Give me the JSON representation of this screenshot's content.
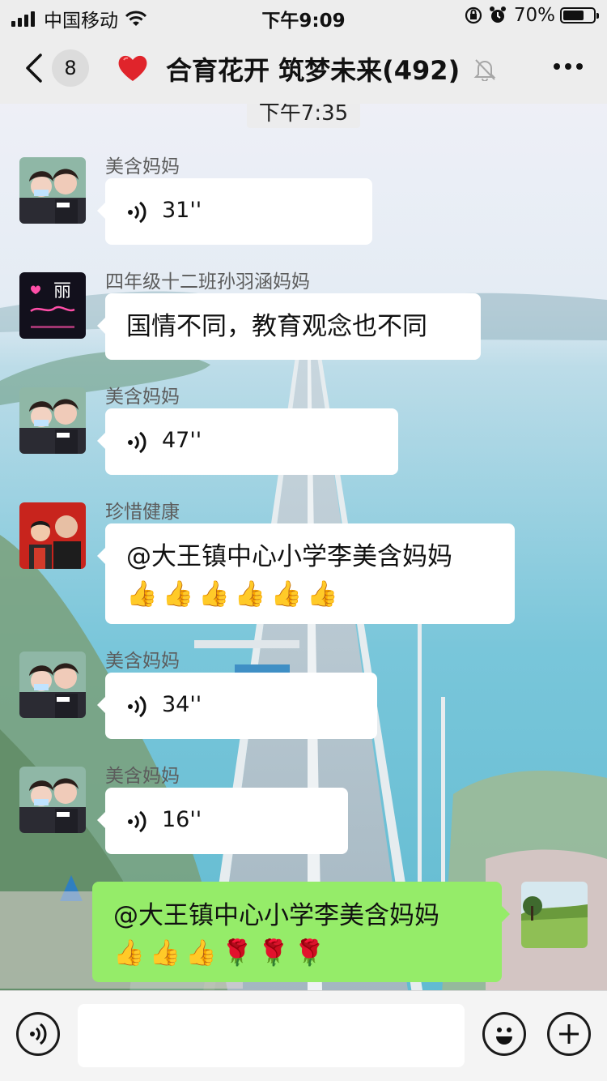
{
  "status_bar": {
    "carrier": "中国移动",
    "time": "下午9:09",
    "battery": "70%"
  },
  "nav": {
    "unread_count": "8",
    "title": "合育花开 筑梦未来(492)"
  },
  "time_divider": "下午7:35",
  "messages": [
    {
      "sender": "美含妈妈",
      "type": "voice",
      "duration": "31''"
    },
    {
      "sender": "四年级十二班孙羽涵妈妈",
      "type": "text",
      "text": "国情不同，教育观念也不同"
    },
    {
      "sender": "美含妈妈",
      "type": "voice",
      "duration": "47''"
    },
    {
      "sender": "珍惜健康",
      "type": "text",
      "text": "@大王镇中心小学李美含妈妈",
      "emoji": [
        "👍",
        "👍",
        "👍",
        "👍",
        "👍",
        "👍"
      ]
    },
    {
      "sender": "美含妈妈",
      "type": "voice",
      "duration": "34''"
    },
    {
      "sender": "美含妈妈",
      "type": "voice",
      "duration": "16''"
    },
    {
      "sender": "",
      "type": "text",
      "mine": true,
      "text": "@大王镇中心小学李美含妈妈",
      "emoji": [
        "👍",
        "👍",
        "👍",
        "🌹",
        "🌹",
        "🌹"
      ]
    }
  ],
  "avatar_text": {
    "pink_avatar_label": "丽"
  },
  "input_bar": {
    "placeholder": ""
  },
  "colors": {
    "my_bubble": "#95ec69",
    "other_bubble": "#ffffff",
    "header_bg": "#ededed"
  }
}
